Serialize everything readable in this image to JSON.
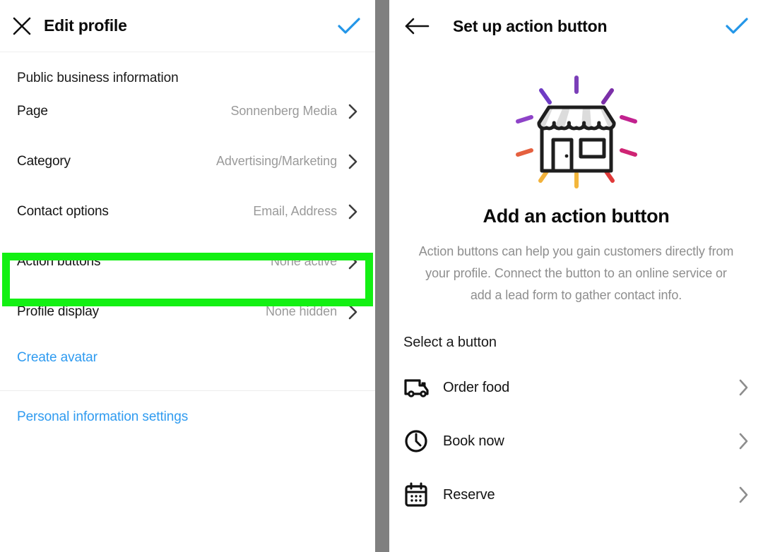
{
  "left_panel": {
    "header": {
      "close_icon": "close-icon",
      "title": "Edit profile",
      "confirm_icon": "checkmark-icon"
    },
    "section_title": "Public business information",
    "rows": [
      {
        "label": "Page",
        "value": "Sonnenberg Media",
        "chevron": "chevron-right-icon"
      },
      {
        "label": "Category",
        "value": "Advertising/Marketing",
        "chevron": "chevron-right-icon"
      },
      {
        "label": "Contact options",
        "value": "Email, Address",
        "chevron": "chevron-right-icon"
      },
      {
        "label": "Action buttons",
        "value": "None active",
        "chevron": "chevron-right-icon"
      },
      {
        "label": "Profile display",
        "value": "None hidden",
        "chevron": "chevron-right-icon"
      }
    ],
    "links": [
      {
        "label": "Create avatar"
      },
      {
        "label": "Personal information settings"
      }
    ],
    "highlight": {
      "target_label": "Action buttons",
      "color": "#13f013"
    }
  },
  "right_panel": {
    "header": {
      "back_icon": "arrow-left-icon",
      "title": "Set up action button",
      "confirm_icon": "checkmark-icon"
    },
    "hero": {
      "illustration": "storefront-illustration",
      "title": "Add an action button",
      "description": "Action buttons can help you gain customers directly from your profile. Connect the button to an online service or add a lead form to gather contact info."
    },
    "select_section_title": "Select a button",
    "options": [
      {
        "icon": "delivery-truck-icon",
        "label": "Order food",
        "chevron": "chevron-right-icon"
      },
      {
        "icon": "clock-icon",
        "label": "Book now",
        "chevron": "chevron-right-icon"
      },
      {
        "icon": "calendar-icon",
        "label": "Reserve",
        "chevron": "chevron-right-icon"
      }
    ]
  },
  "colors": {
    "accent_blue": "#2f9bf0",
    "highlight_green": "#13f013",
    "gutter_gray": "#808080",
    "muted_text": "#9a9a9a"
  }
}
